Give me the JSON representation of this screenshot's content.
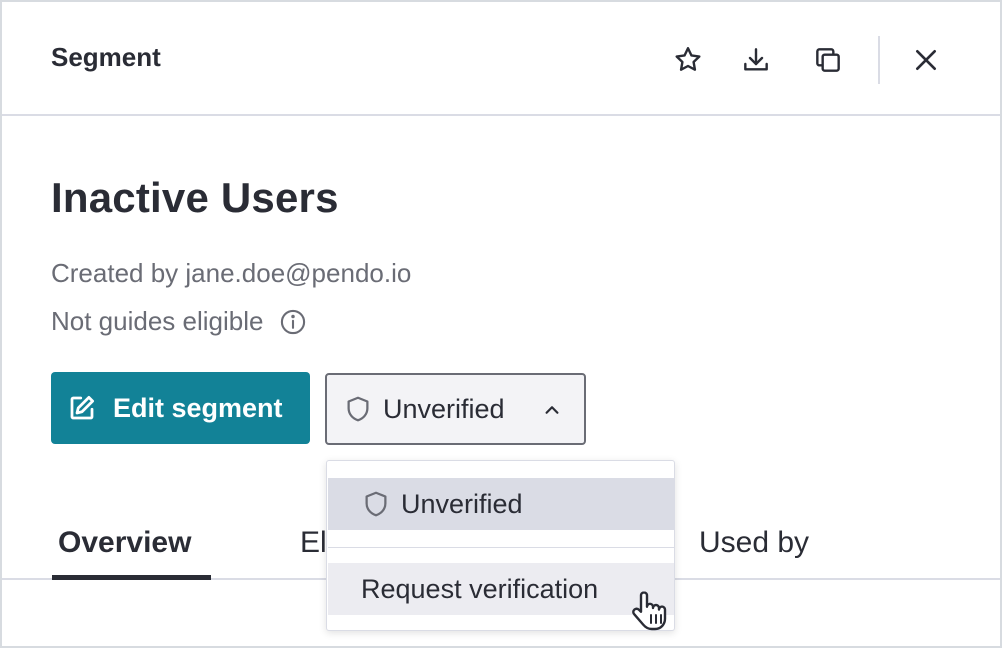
{
  "header": {
    "title": "Segment",
    "icons": [
      "star-icon",
      "download-icon",
      "copy-icon",
      "close-icon"
    ]
  },
  "segment": {
    "name": "Inactive Users",
    "created_by": "Created by jane.doe@pendo.io",
    "guides_status": "Not guides eligible"
  },
  "actions": {
    "edit_label": "Edit segment",
    "verification_label": "Unverified"
  },
  "tabs": [
    {
      "label": "Overview",
      "active": true
    },
    {
      "label": "El",
      "active": false
    },
    {
      "label": "Used by",
      "active": false
    }
  ],
  "dropdown": {
    "selected_label": "Unverified",
    "options": [
      {
        "label": "Request verification"
      }
    ]
  },
  "colors": {
    "primary": "#128297",
    "text": "#2a2c35",
    "muted": "#6a6c75",
    "border": "#dadce5"
  }
}
